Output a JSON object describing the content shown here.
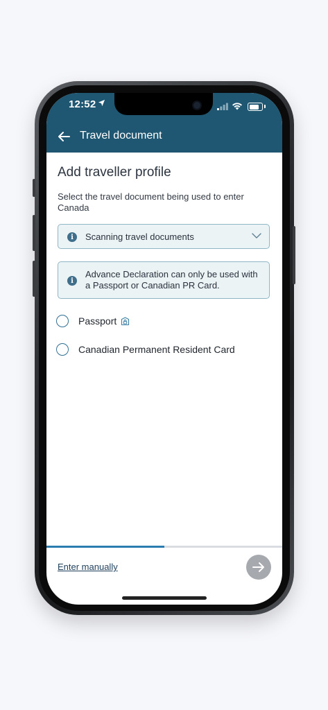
{
  "status_bar": {
    "time": "12:52"
  },
  "header": {
    "title": "Travel document",
    "back_icon": "arrow-left-icon"
  },
  "main": {
    "title": "Add traveller profile",
    "subtitle": "Select the travel document being used to enter Canada",
    "accordion": {
      "label": "Scanning travel documents",
      "icon": "info-icon"
    },
    "notice": {
      "text": "Advance Declaration can only be used with a Passport or Canadian PR Card.",
      "icon": "info-icon"
    },
    "options": [
      {
        "label": "Passport",
        "selected": false,
        "icon": "lock-icon"
      },
      {
        "label": "Canadian Permanent Resident Card",
        "selected": false
      }
    ]
  },
  "footer": {
    "progress": 0.5,
    "enter_manually": "Enter manually",
    "next_icon": "arrow-right-icon"
  },
  "colors": {
    "header_bg": "#1f5772",
    "accent": "#2a7bb0",
    "info_bg": "#ebf3f5",
    "next_disabled": "#a6a9ad"
  }
}
